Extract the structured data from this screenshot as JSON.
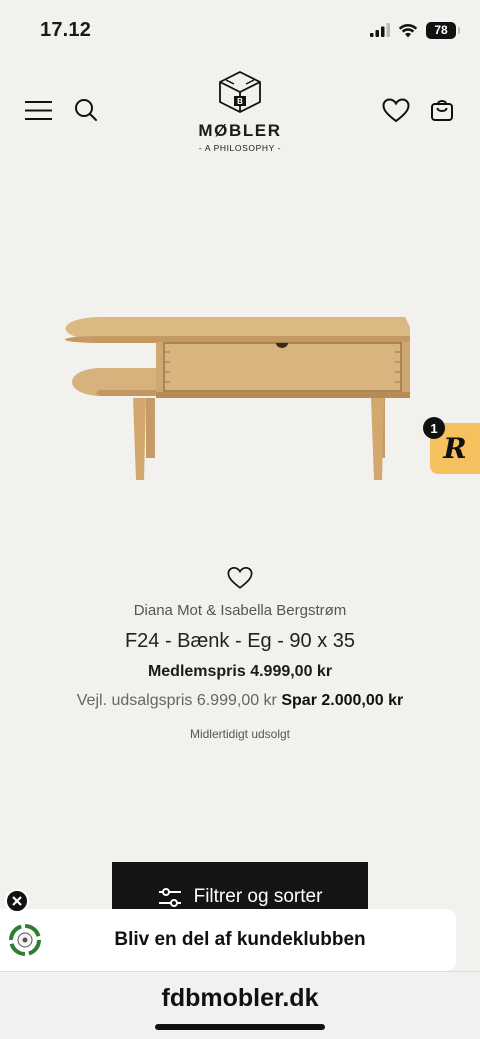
{
  "status_bar": {
    "time": "17.12",
    "battery": "78"
  },
  "header": {
    "logo_word": "MØBLER",
    "logo_tagline": "- A PHILOSOPHY -",
    "icons": [
      "menu-icon",
      "search-icon",
      "heart-icon",
      "bag-icon"
    ]
  },
  "rewards": {
    "letter": "R",
    "badge_count": "1"
  },
  "product": {
    "designer": "Diana Mot & Isabella Bergstrøm",
    "title": "F24 - Bænk - Eg - 90 x 35",
    "member_price": "Medlemspris 4.999,00 kr",
    "retail_price": "Vejl. udsalgspris 6.999,00 kr",
    "savings": "Spar 2.000,00 kr",
    "stock_status": "Midlertidigt udsolgt"
  },
  "filter_button": {
    "label": "Filtrer og sorter"
  },
  "club_banner": {
    "label": "Bliv en del af kundeklubben"
  },
  "browser": {
    "url": "fdbmobler.dk"
  },
  "colors": {
    "background": "#f2f1ed",
    "button": "#141414",
    "rewards": "#f4c15e"
  }
}
